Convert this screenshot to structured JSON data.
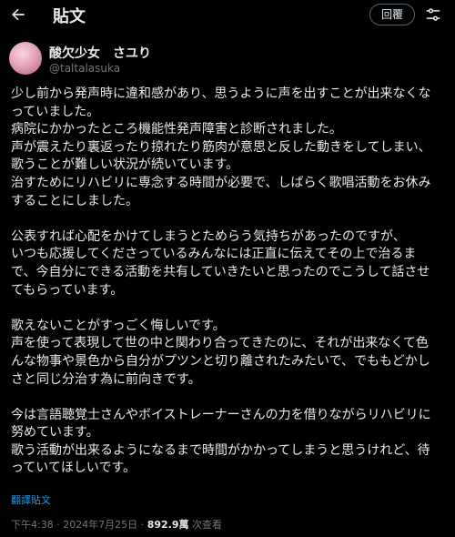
{
  "header": {
    "back_icon": "back-arrow-icon",
    "title": "貼文",
    "reply_label": "回覆",
    "options_icon": "options-icon"
  },
  "author": {
    "display_name": "酸欠少女　さユり",
    "handle": "@taltalasuka"
  },
  "post": {
    "paragraphs": [
      {
        "lines": [
          "少し前から発声時に違和感があり、思うように声を出すことが出来なくな",
          "っていました。",
          "病院にかかったところ機能性発声障害と診断されました。",
          "声が震えたり裏返ったり掠れたり筋肉が意思と反した動きをしてしまい、",
          "歌うことが難しい状況が続いています。",
          "治すためにリハビリに専念する時間が必要で、しばらく歌唱活動をお休み",
          "することにしました。"
        ]
      },
      {
        "lines": [
          "公表すれば心配をかけてしまうとためらう気持ちがあったのですが、",
          "いつも応援してくださっているみんなには正直に伝えてその上で治るま",
          "で、今自分にできる活動を共有していきたいと思ったのでこうして話させ",
          "てもらっています。"
        ]
      },
      {
        "lines": [
          "歌えないことがすっごく悔しいです。",
          "声を使って表現して世の中と関わり合ってきたのに、それが出来なくて色",
          "んな物事や景色から自分がプツンと切り離されたみたいで、でももどかし",
          "さと同じ分治す為に前向きです。"
        ]
      },
      {
        "lines": [
          "今は言語聴覚士さんやボイストレーナーさんの力を借りながらリハビリに",
          "努めています。",
          "歌う活動が出来るようになるまで時間がかかってしまうと思うけれど、待",
          "っていてほしいです。"
        ]
      }
    ],
    "translate_label": "翻譯貼文",
    "timestamp": "下午4:38 · 2024年7月25日",
    "separator": "·",
    "views_count": "892.9萬",
    "views_label": "次查看"
  },
  "colors": {
    "background": "#000000",
    "text": "#e7e9ea",
    "secondary": "#71767b",
    "link": "#1d9bf0"
  }
}
